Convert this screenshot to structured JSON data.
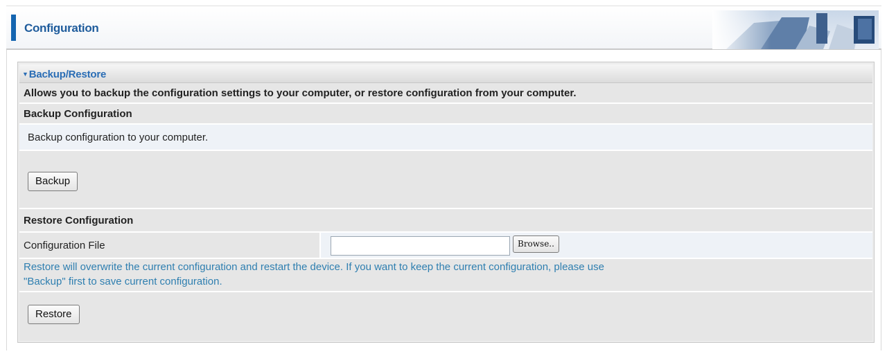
{
  "header": {
    "title": "Configuration",
    "accent_color": "#1565b0",
    "title_color": "#1f5c9c"
  },
  "panel": {
    "title": "Backup/Restore",
    "expand_icon": "triangle-down-icon",
    "title_color": "#2a6db5"
  },
  "intro": {
    "text": "Allows you to backup the configuration settings to your computer, or restore configuration from your computer."
  },
  "backup": {
    "heading": "Backup Configuration",
    "description": "Backup configuration to your computer.",
    "button_label": "Backup"
  },
  "restore": {
    "heading": "Restore Configuration",
    "file_label": "Configuration File",
    "file_value": "",
    "browse_label": "Browse..",
    "note_line1": "Restore will overwrite the current configuration and restart the device. If you want to keep the current configuration, please use",
    "note_line2": "\"Backup\" first to save current configuration.",
    "note_color": "#2f7fb0",
    "button_label": "Restore"
  }
}
